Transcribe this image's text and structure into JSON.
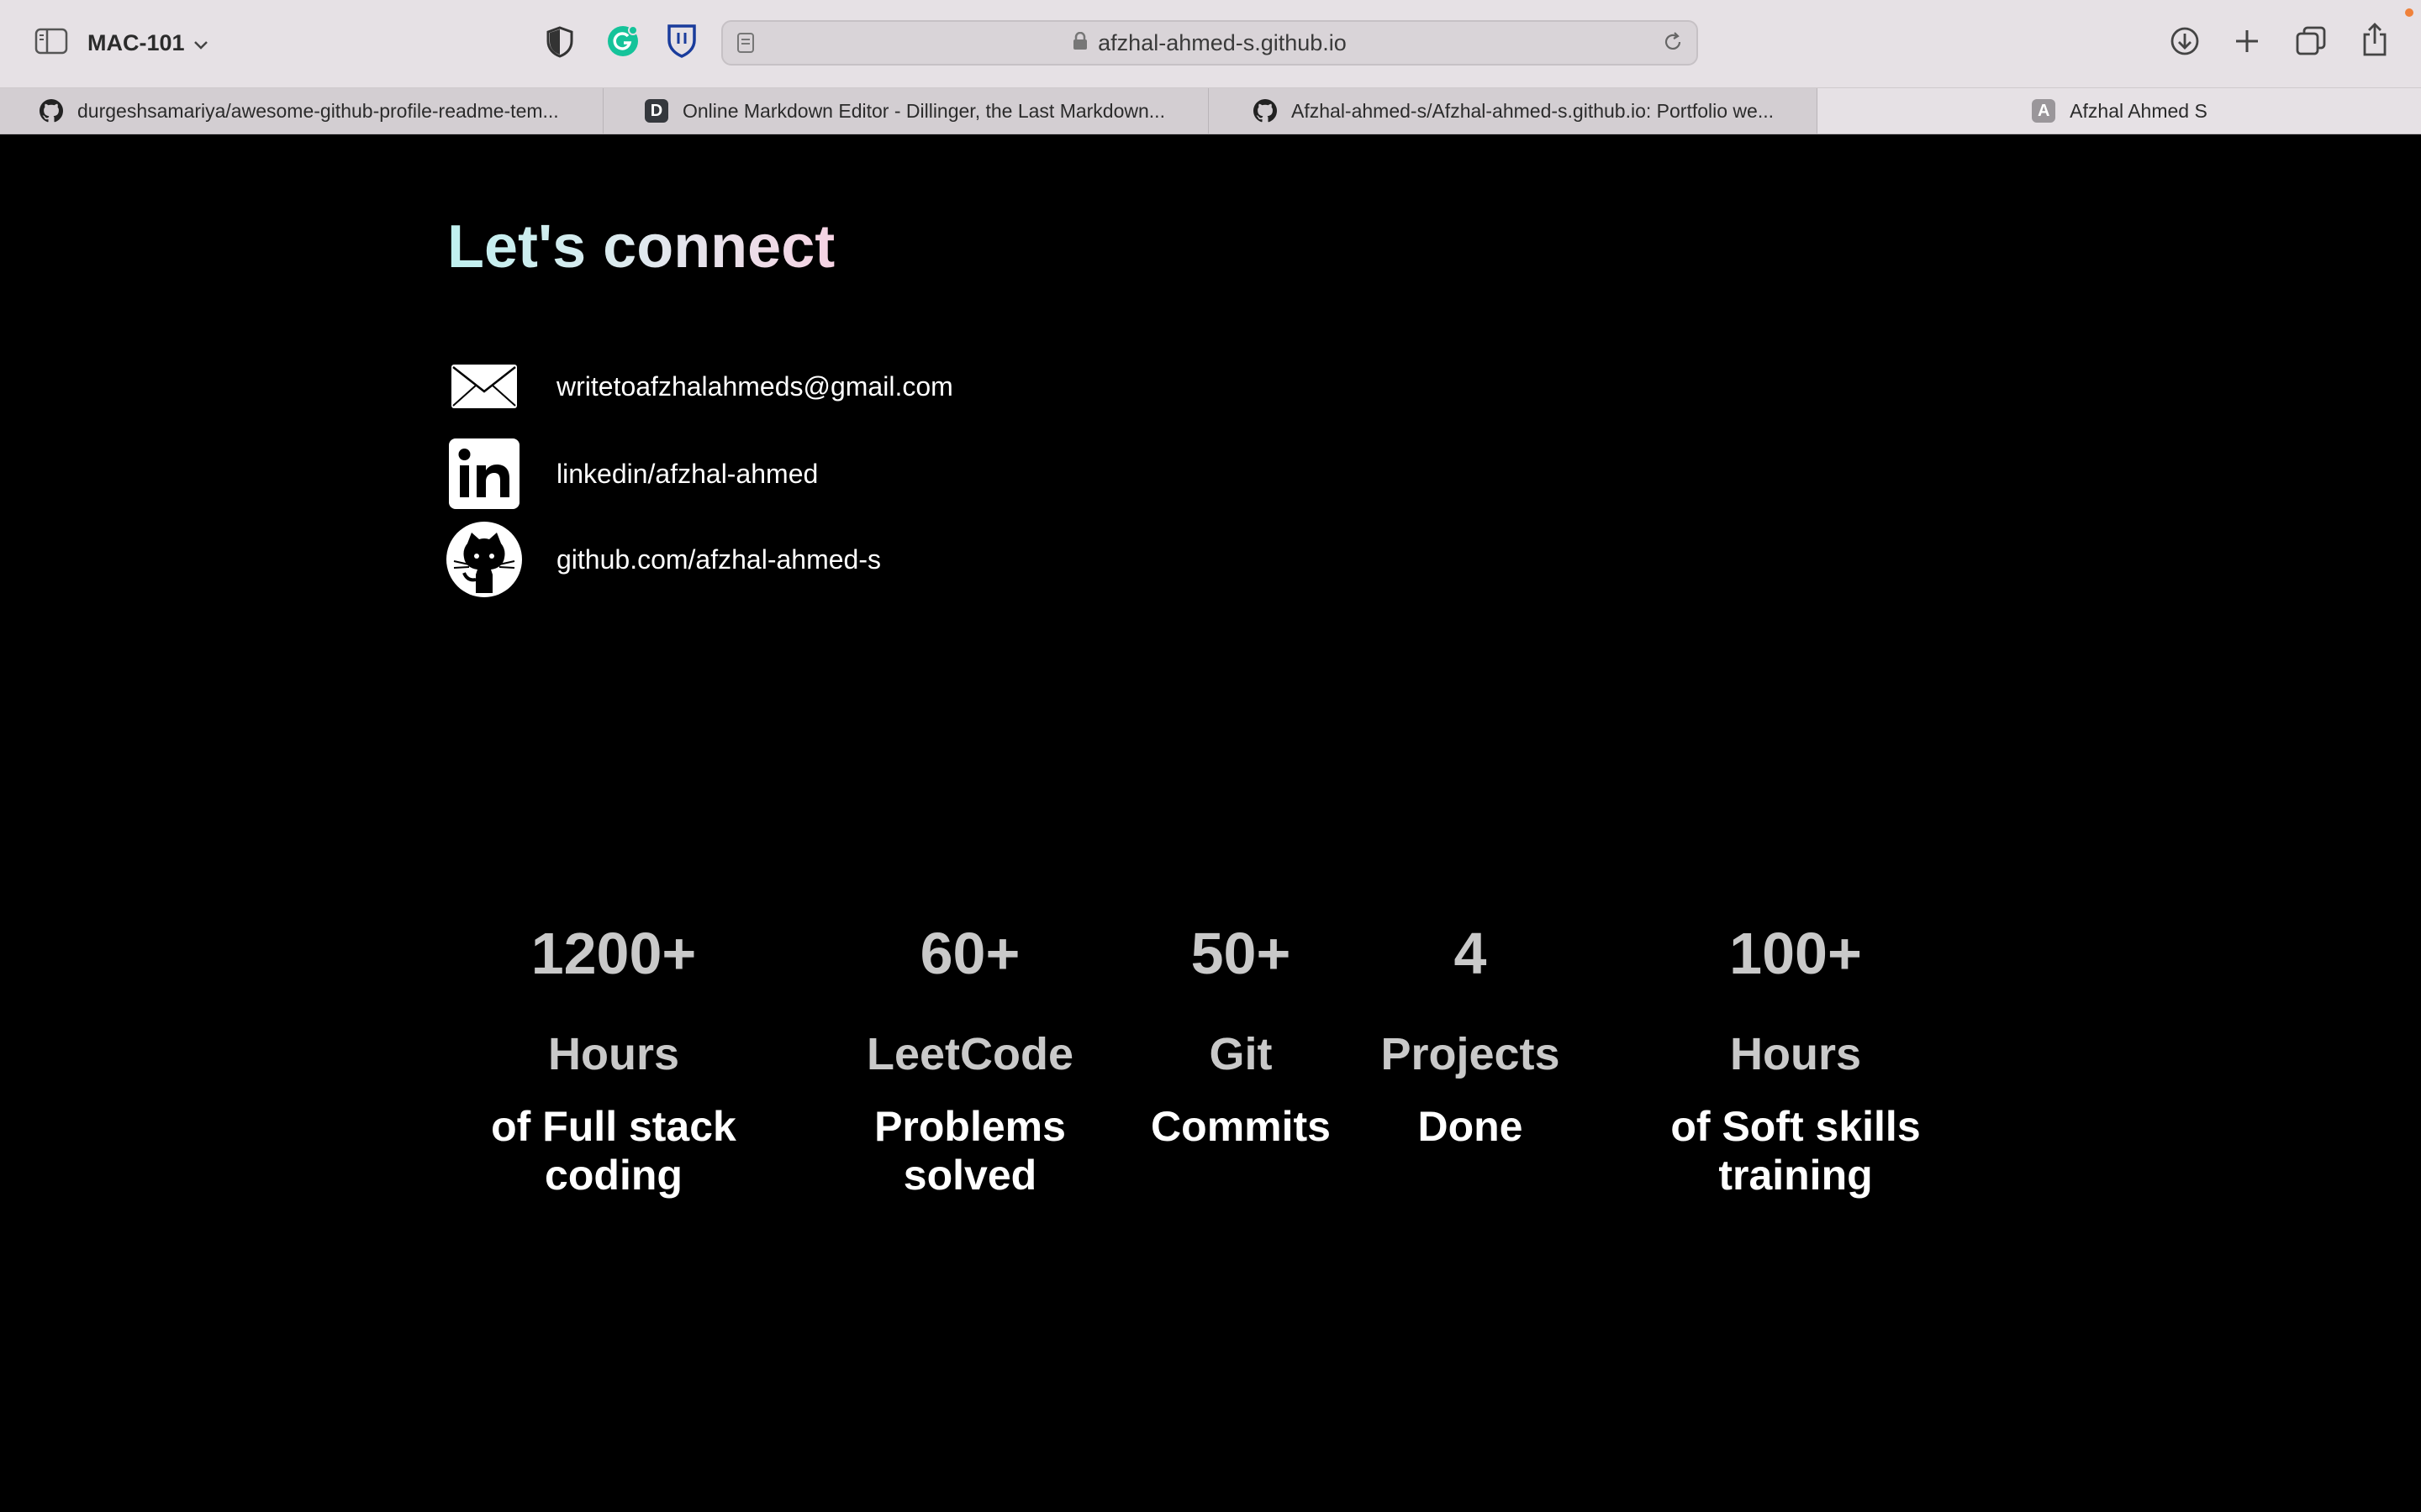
{
  "browser": {
    "profile_name": "MAC-101",
    "url": "afzhal-ahmed-s.github.io",
    "tabs": [
      {
        "title": "durgeshsamariya/awesome-github-profile-readme-tem...",
        "favicon": "github-icon"
      },
      {
        "title": "Online Markdown Editor - Dillinger, the Last Markdown...",
        "favicon": "dillinger-icon",
        "favicon_letter": "D"
      },
      {
        "title": "Afzhal-ahmed-s/Afzhal-ahmed-s.github.io: Portfolio we...",
        "favicon": "github-icon"
      },
      {
        "title": "Afzhal Ahmed S",
        "favicon": "site-letter-icon",
        "favicon_letter": "A",
        "active": true
      }
    ],
    "icons": [
      "sidebar-icon",
      "chevron-down-icon",
      "shield-icon",
      "grammarly-icon",
      "bitwarden-icon",
      "reader-icon",
      "lock-icon",
      "reload-icon",
      "download-icon",
      "plus-icon",
      "tabs-overview-icon",
      "share-icon"
    ]
  },
  "page": {
    "connect_title": "Let's connect",
    "contacts": [
      {
        "icon": "mail-icon",
        "text": "writetoafzhalahmeds@gmail.com"
      },
      {
        "icon": "linkedin-icon",
        "text": "linkedin/afzhal-ahmed"
      },
      {
        "icon": "github-icon",
        "text": "github.com/afzhal-ahmed-s"
      }
    ],
    "stats": [
      {
        "value": "1200+",
        "unit": "Hours",
        "desc_line1": "of Full stack",
        "desc_line2": "coding"
      },
      {
        "value": "60+",
        "unit": "LeetCode",
        "desc_line1": "Problems",
        "desc_line2": "solved"
      },
      {
        "value": "50+",
        "unit": "Git",
        "desc_line1": "Commits",
        "desc_line2": ""
      },
      {
        "value": "4",
        "unit": "Projects",
        "desc_line1": "Done",
        "desc_line2": ""
      },
      {
        "value": "100+",
        "unit": "Hours",
        "desc_line1": "of Soft skills",
        "desc_line2": "training"
      }
    ]
  },
  "colors": {
    "page_background": "#000000",
    "title_gradient_start": "#bff0ef",
    "title_gradient_end": "#f6d3e3",
    "stat_number": "#c9c9c9",
    "stat_desc": "#ffffff",
    "chrome_background": "#e6e1e5"
  }
}
